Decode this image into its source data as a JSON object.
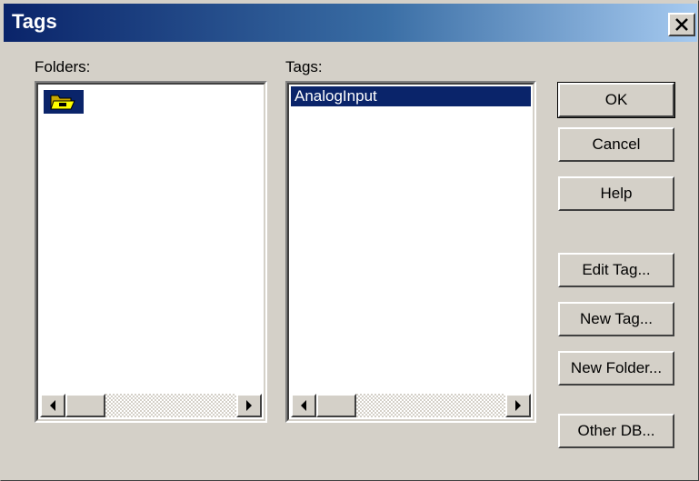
{
  "window": {
    "title": "Tags"
  },
  "folders": {
    "label": "Folders:"
  },
  "tags": {
    "label": "Tags:",
    "items": [
      "AnalogInput"
    ],
    "selected": "AnalogInput"
  },
  "buttons": {
    "ok": "OK",
    "cancel": "Cancel",
    "help": "Help",
    "edit_tag": "Edit Tag...",
    "new_tag": "New Tag...",
    "new_folder": "New Folder...",
    "other_db": "Other DB..."
  },
  "colors": {
    "title_start": "#0a246a",
    "title_end": "#a6caf0",
    "selection": "#0a246a",
    "face": "#d4d0c8"
  },
  "icons": {
    "folder": "open-folder-icon",
    "close": "close-icon",
    "scroll_left": "arrow-left-icon",
    "scroll_right": "arrow-right-icon"
  }
}
